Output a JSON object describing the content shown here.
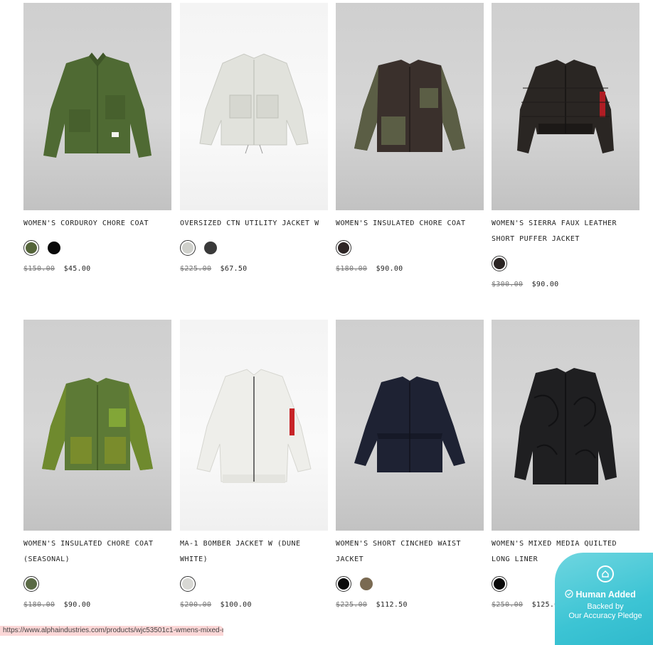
{
  "products": [
    {
      "title": "WOMEN'S CORDUROY CHORE COAT",
      "old_price": "$150.00",
      "new_price": "$45.00",
      "swatches": [
        "#55653a",
        "#0a0a0a"
      ],
      "jacket_color": "#4f6a33"
    },
    {
      "title": "OVERSIZED CTN UTILITY JACKET W",
      "old_price": "$225.00",
      "new_price": "$67.50",
      "swatches": [
        "#cfd0cb",
        "#3a3a3a"
      ],
      "jacket_color": "#e1e2dc"
    },
    {
      "title": "WOMEN'S INSULATED CHORE COAT",
      "old_price": "$180.00",
      "new_price": "$90.00",
      "swatches": [
        "#2e2626"
      ],
      "jacket_color": "#3a302c"
    },
    {
      "title": "WOMEN'S SIERRA FAUX LEATHER SHORT PUFFER JACKET",
      "old_price": "$300.00",
      "new_price": "$90.00",
      "swatches": [
        "#2b2524"
      ],
      "jacket_color": "#2a2623"
    },
    {
      "title": "WOMEN'S INSULATED CHORE COAT (SEASONAL)",
      "old_price": "$180.00",
      "new_price": "$90.00",
      "swatches": [
        "#5a6a45"
      ],
      "jacket_color": "#5d7a36"
    },
    {
      "title": "MA-1 BOMBER JACKET W (DUNE WHITE)",
      "old_price": "$200.00",
      "new_price": "$100.00",
      "swatches": [
        "#d8d8d4"
      ],
      "jacket_color": "#eeeeea"
    },
    {
      "title": "WOMEN'S SHORT CINCHED WAIST JACKET",
      "old_price": "$225.00",
      "new_price": "$112.50",
      "swatches": [
        "#0a0a0a",
        "#7a6a52"
      ],
      "jacket_color": "#1e2233"
    },
    {
      "title": "WOMEN'S MIXED MEDIA QUILTED LONG LINER",
      "old_price": "$250.00",
      "new_price": "$125.00",
      "swatches": [
        "#0a0a0a"
      ],
      "jacket_color": "#1f1f21"
    }
  ],
  "badge": {
    "title": "Human Added",
    "line1": "Backed by",
    "line2": "Our Accuracy Pledge",
    "icon": "home-icon",
    "check_icon": "check-circle-icon",
    "color": "#3cc4d4"
  },
  "status_url": "https://www.alphaindustries.com/products/wjc53501c1-wmens-mixed-media"
}
